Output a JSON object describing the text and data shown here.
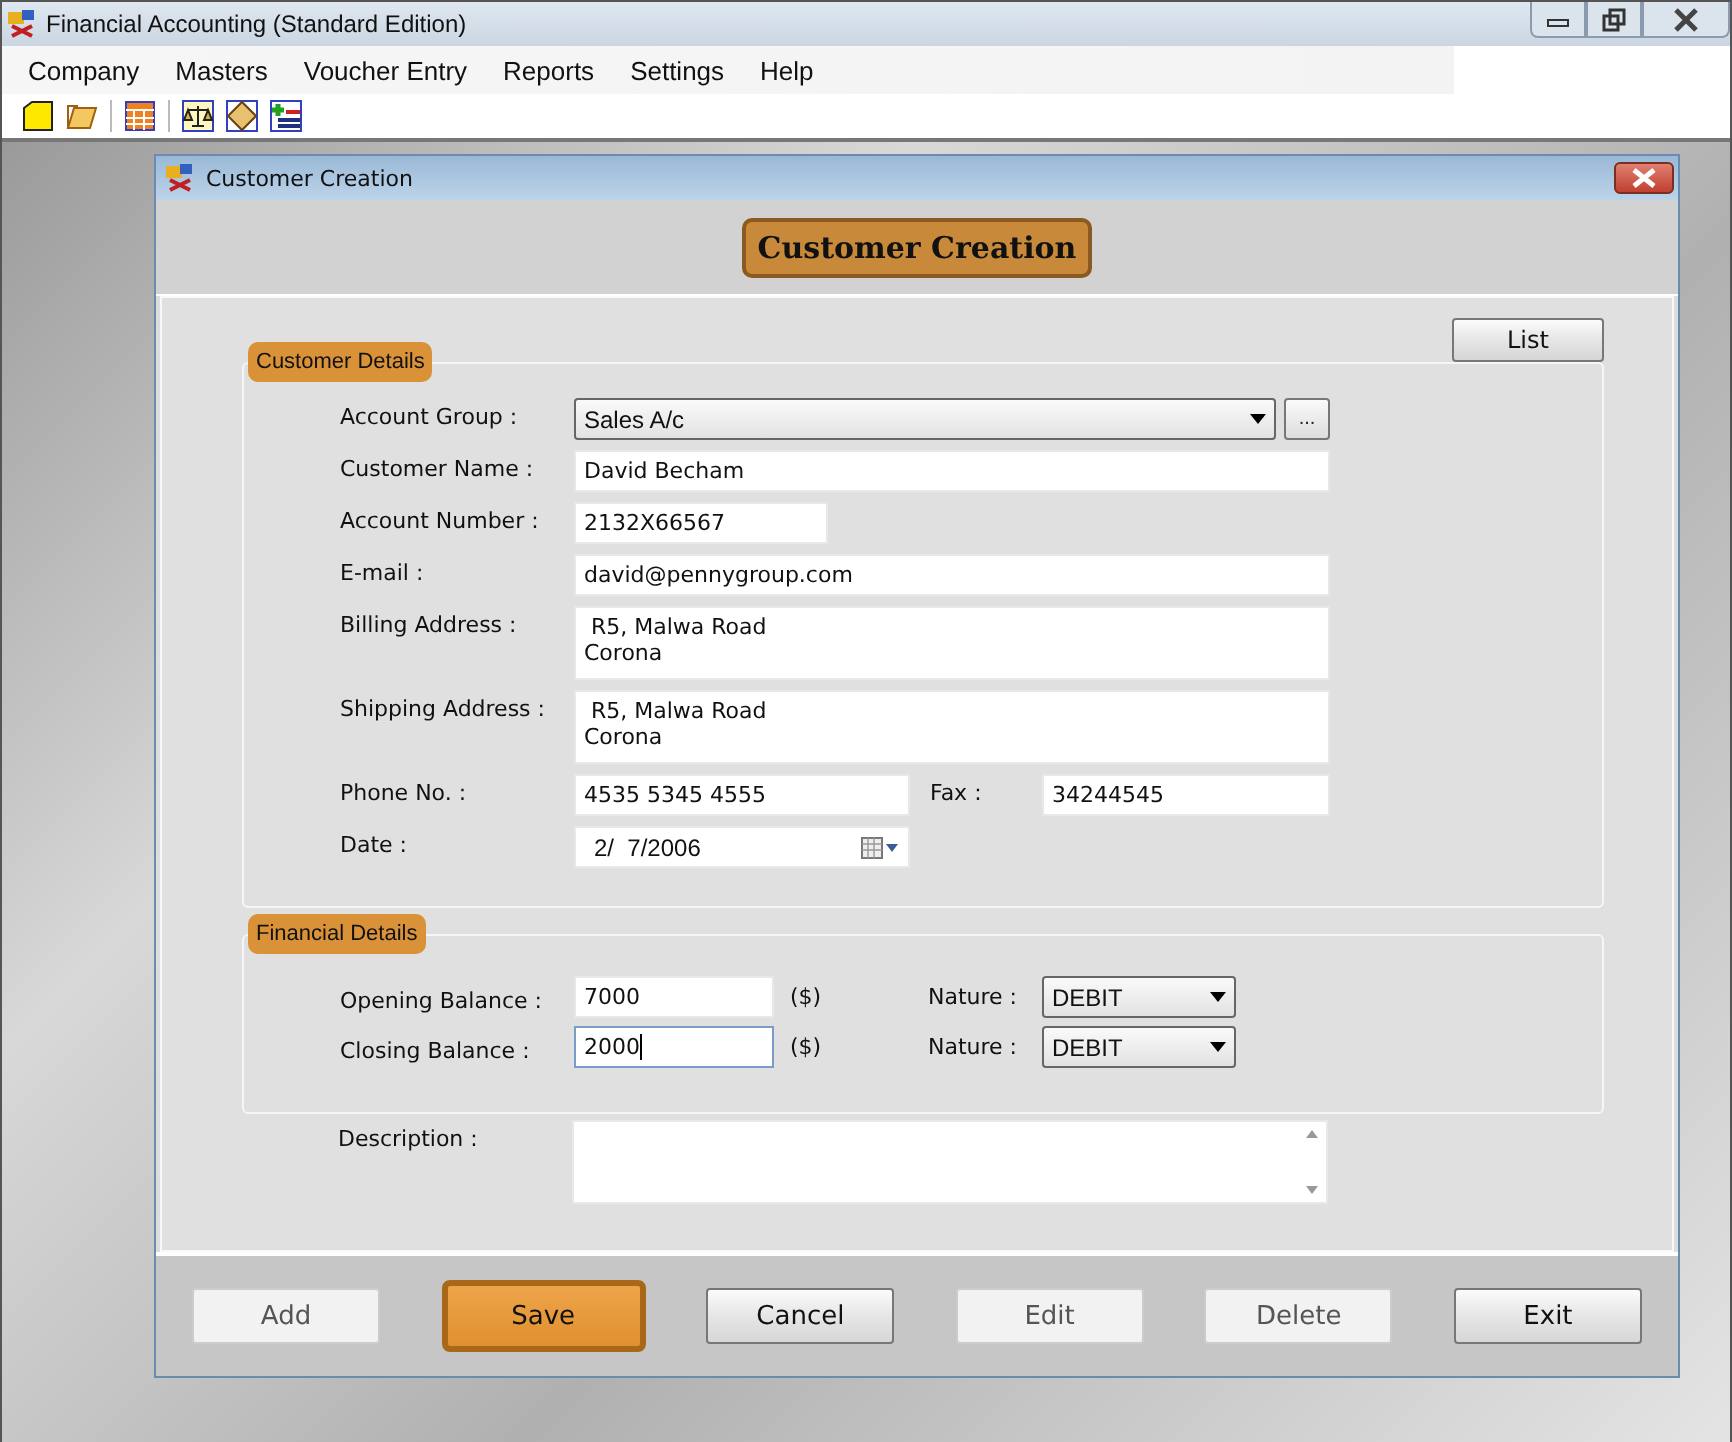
{
  "window": {
    "title": "Financial Accounting (Standard Edition)"
  },
  "menu": [
    "Company",
    "Masters",
    "Voucher Entry",
    "Reports",
    "Settings",
    "Help"
  ],
  "dialog": {
    "title": "Customer Creation",
    "heading": "Customer Creation",
    "list_button": "List",
    "customer_details": {
      "legend": "Customer Details",
      "fields": [
        {
          "kind": "select",
          "label": "Account Group :",
          "value": "Sales A/c",
          "browse": "..."
        },
        {
          "kind": "text",
          "label": "Customer Name :",
          "value": "David Becham"
        },
        {
          "kind": "short",
          "label": "Account Number :",
          "value": "2132X66567"
        },
        {
          "kind": "text",
          "label": "E-mail :",
          "value": "david@pennygroup.com"
        },
        {
          "kind": "multiline",
          "label": "Billing Address :",
          "value": " R5, Malwa Road\nCorona"
        },
        {
          "kind": "multiline",
          "label": "Shipping Address :",
          "value": " R5, Malwa Road\nCorona"
        },
        {
          "kind": "pair",
          "label": "Phone No. :",
          "value": "4535 5345 4555",
          "label_2": "Fax :",
          "value_2": "34244545"
        },
        {
          "kind": "date",
          "label": "Date :",
          "value": "2/  7/2006"
        }
      ]
    },
    "financial_details": {
      "legend": "Financial Details",
      "rows": [
        {
          "label": "Opening Balance :",
          "value": "7000",
          "unit": "($)",
          "nature_label": "Nature :",
          "nature": "DEBIT",
          "focused": false
        },
        {
          "label": "Closing Balance :",
          "value": "2000",
          "unit": "($)",
          "nature_label": "Nature :",
          "nature": "DEBIT",
          "focused": true
        }
      ]
    },
    "description": {
      "label": "Description :"
    },
    "buttons": [
      {
        "label": "Add",
        "disabled": true,
        "selected": false
      },
      {
        "label": "Save",
        "disabled": false,
        "selected": true
      },
      {
        "label": "Cancel",
        "disabled": false,
        "selected": false
      },
      {
        "label": "Edit",
        "disabled": true,
        "selected": false
      },
      {
        "label": "Delete",
        "disabled": true,
        "selected": false
      },
      {
        "label": "Exit",
        "disabled": false,
        "selected": false
      }
    ]
  }
}
